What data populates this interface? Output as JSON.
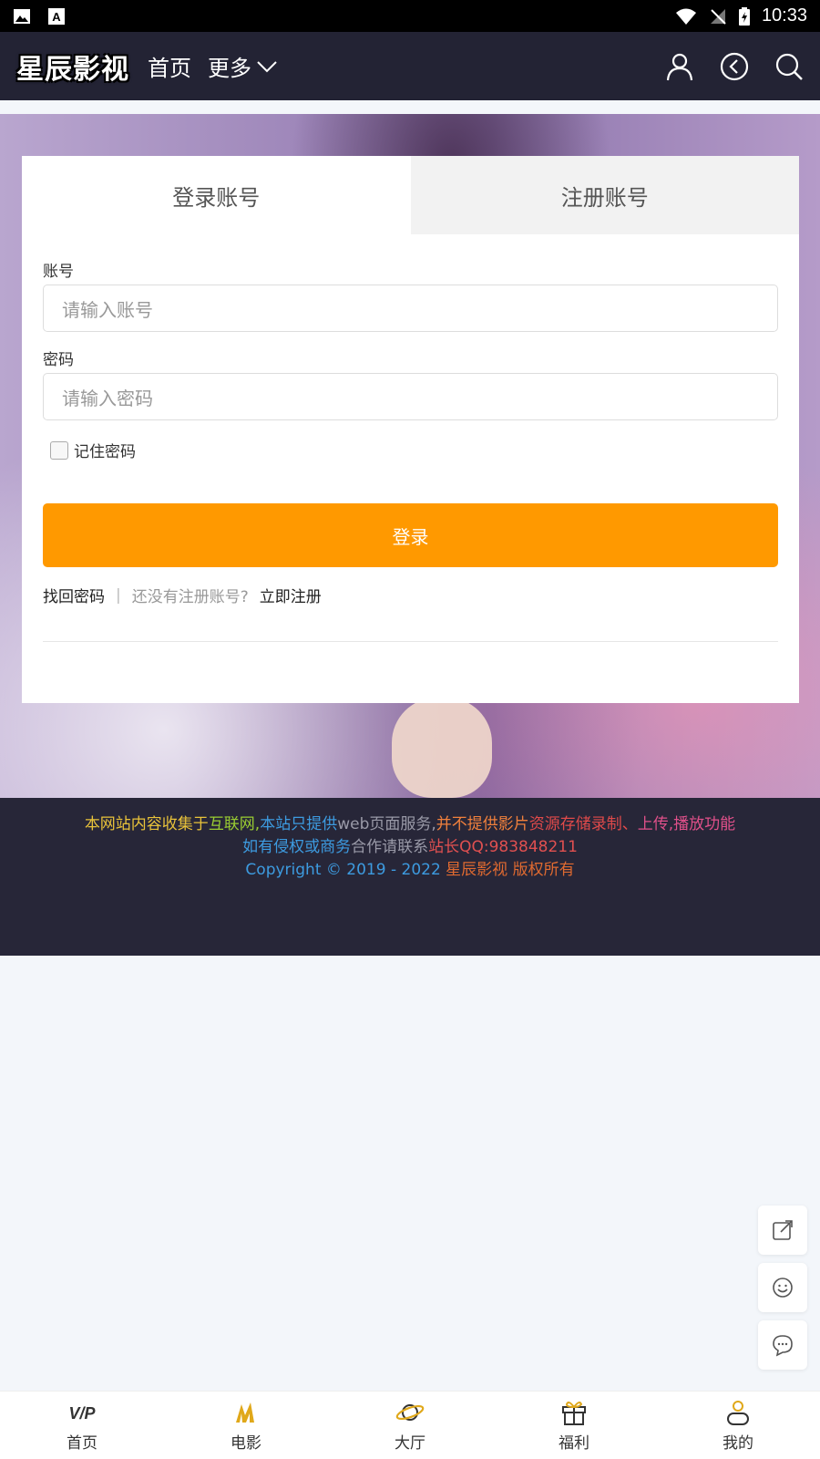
{
  "status_bar": {
    "time": "10:33",
    "icons": [
      "image-icon",
      "a-icon",
      "wifi-icon",
      "no-signal-icon",
      "battery-charging-icon"
    ]
  },
  "header": {
    "logo": "星辰影视",
    "nav": {
      "home": "首页",
      "more": "更多"
    },
    "icons": [
      "user-icon",
      "history-icon",
      "search-icon"
    ]
  },
  "login": {
    "tabs": {
      "login": "登录账号",
      "register": "注册账号"
    },
    "account_label": "账号",
    "account_placeholder": "请输入账号",
    "password_label": "密码",
    "password_placeholder": "请输入密码",
    "remember_label": "记住密码",
    "submit_label": "登录",
    "forgot_link": "找回密码",
    "separator": "|",
    "no_account_text": "还没有注册账号?",
    "register_link": "立即注册"
  },
  "footer": {
    "line1": [
      {
        "text": "本网站内容收集于",
        "color": "#e8c23a"
      },
      {
        "text": "互联网,",
        "color": "#9acd32"
      },
      {
        "text": "本站只提供",
        "color": "#3d9be0"
      },
      {
        "text": "web页面服务,",
        "color": "#9a9aa8"
      },
      {
        "text": "并不提供影片",
        "color": "#f0803c"
      },
      {
        "text": "资源存储录制、",
        "color": "#e04a4a"
      },
      {
        "text": "上传,播放功能",
        "color": "#e0508a"
      }
    ],
    "line2": [
      {
        "text": "如有侵权或商务",
        "color": "#3d9be0"
      },
      {
        "text": "合作请联系",
        "color": "#9a9aa8"
      },
      {
        "text": "站长QQ:983848211",
        "color": "#e05050"
      }
    ],
    "line3": [
      {
        "text": "Copyright © 2019 - 2022 ",
        "color": "#3d9be0"
      },
      {
        "text": "星辰影视 版权所有",
        "color": "#e06a30"
      }
    ]
  },
  "float_buttons": [
    "share-icon",
    "smile-icon",
    "chat-icon"
  ],
  "tabbar": [
    {
      "label": "首页",
      "icon": "vip-icon"
    },
    {
      "label": "电影",
      "icon": "movie-icon"
    },
    {
      "label": "大厅",
      "icon": "planet-icon"
    },
    {
      "label": "福利",
      "icon": "gift-icon"
    },
    {
      "label": "我的",
      "icon": "profile-icon"
    }
  ],
  "colors": {
    "header_bg": "#232334",
    "accent": "#ff9900",
    "footer_bg": "#272638",
    "page_bg": "#f3f6fa"
  }
}
